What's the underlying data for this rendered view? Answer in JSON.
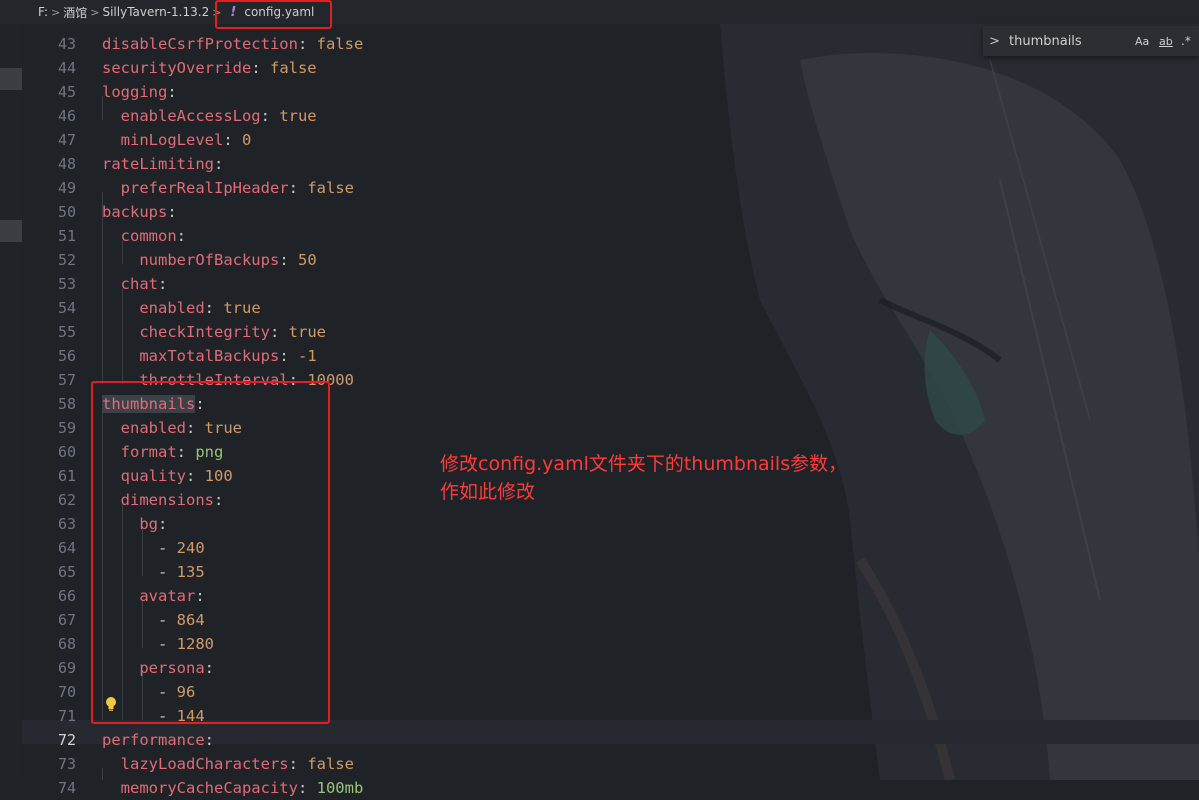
{
  "breadcrumb": {
    "segments": [
      "F:",
      "酒馆",
      "SillyTavern-1.13.2"
    ],
    "file_icon": "!",
    "file_name": "config.yaml"
  },
  "find_widget": {
    "query": "thumbnails",
    "case_label": "Aa",
    "word_label": "ab",
    "regex_label": ".*"
  },
  "annotation": {
    "line1": "修改config.yaml文件夹下的thumbnails参数，",
    "line2": "作如此修改"
  },
  "lines": [
    {
      "n": "43",
      "parts": [
        {
          "t": "disableCsrfProtection",
          "c": "k"
        },
        {
          "t": ": ",
          "c": "p"
        },
        {
          "t": "false",
          "c": "v"
        }
      ]
    },
    {
      "n": "44",
      "parts": [
        {
          "t": "securityOverride",
          "c": "k"
        },
        {
          "t": ": ",
          "c": "p"
        },
        {
          "t": "false",
          "c": "v"
        }
      ]
    },
    {
      "n": "45",
      "parts": [
        {
          "t": "logging",
          "c": "k"
        },
        {
          "t": ":",
          "c": "p"
        }
      ]
    },
    {
      "n": "46",
      "parts": [
        {
          "t": "  enableAccessLog",
          "c": "k"
        },
        {
          "t": ": ",
          "c": "p"
        },
        {
          "t": "true",
          "c": "v"
        }
      ]
    },
    {
      "n": "47",
      "parts": [
        {
          "t": "  minLogLevel",
          "c": "k"
        },
        {
          "t": ": ",
          "c": "p"
        },
        {
          "t": "0",
          "c": "v"
        }
      ]
    },
    {
      "n": "48",
      "parts": [
        {
          "t": "rateLimiting",
          "c": "k"
        },
        {
          "t": ":",
          "c": "p"
        }
      ]
    },
    {
      "n": "49",
      "parts": [
        {
          "t": "  preferRealIpHeader",
          "c": "k"
        },
        {
          "t": ": ",
          "c": "p"
        },
        {
          "t": "false",
          "c": "v"
        }
      ]
    },
    {
      "n": "50",
      "parts": [
        {
          "t": "backups",
          "c": "k"
        },
        {
          "t": ":",
          "c": "p"
        }
      ]
    },
    {
      "n": "51",
      "parts": [
        {
          "t": "  common",
          "c": "k"
        },
        {
          "t": ":",
          "c": "p"
        }
      ]
    },
    {
      "n": "52",
      "parts": [
        {
          "t": "    numberOfBackups",
          "c": "k"
        },
        {
          "t": ": ",
          "c": "p"
        },
        {
          "t": "50",
          "c": "v"
        }
      ]
    },
    {
      "n": "53",
      "parts": [
        {
          "t": "  chat",
          "c": "k"
        },
        {
          "t": ":",
          "c": "p"
        }
      ]
    },
    {
      "n": "54",
      "parts": [
        {
          "t": "    enabled",
          "c": "k"
        },
        {
          "t": ": ",
          "c": "p"
        },
        {
          "t": "true",
          "c": "v"
        }
      ]
    },
    {
      "n": "55",
      "parts": [
        {
          "t": "    checkIntegrity",
          "c": "k"
        },
        {
          "t": ": ",
          "c": "p"
        },
        {
          "t": "true",
          "c": "v"
        }
      ]
    },
    {
      "n": "56",
      "parts": [
        {
          "t": "    maxTotalBackups",
          "c": "k"
        },
        {
          "t": ": ",
          "c": "p"
        },
        {
          "t": "-1",
          "c": "v"
        }
      ]
    },
    {
      "n": "57",
      "parts": [
        {
          "t": "    throttleInterval",
          "c": "k"
        },
        {
          "t": ": ",
          "c": "p"
        },
        {
          "t": "10000",
          "c": "v"
        }
      ]
    },
    {
      "n": "58",
      "parts": [
        {
          "t": "thumbnails",
          "c": "k hl"
        },
        {
          "t": ":",
          "c": "p"
        }
      ]
    },
    {
      "n": "59",
      "parts": [
        {
          "t": "  enabled",
          "c": "k"
        },
        {
          "t": ": ",
          "c": "p"
        },
        {
          "t": "true",
          "c": "v"
        }
      ]
    },
    {
      "n": "60",
      "parts": [
        {
          "t": "  format",
          "c": "k"
        },
        {
          "t": ": ",
          "c": "p"
        },
        {
          "t": "png",
          "c": "s"
        }
      ]
    },
    {
      "n": "61",
      "parts": [
        {
          "t": "  quality",
          "c": "k"
        },
        {
          "t": ": ",
          "c": "p"
        },
        {
          "t": "100",
          "c": "v"
        }
      ]
    },
    {
      "n": "62",
      "parts": [
        {
          "t": "  dimensions",
          "c": "k"
        },
        {
          "t": ":",
          "c": "p"
        }
      ]
    },
    {
      "n": "63",
      "parts": [
        {
          "t": "    bg",
          "c": "k"
        },
        {
          "t": ":",
          "c": "p"
        }
      ]
    },
    {
      "n": "64",
      "parts": [
        {
          "t": "      - ",
          "c": "p"
        },
        {
          "t": "240",
          "c": "v"
        }
      ]
    },
    {
      "n": "65",
      "parts": [
        {
          "t": "      - ",
          "c": "p"
        },
        {
          "t": "135",
          "c": "v"
        }
      ]
    },
    {
      "n": "66",
      "parts": [
        {
          "t": "    avatar",
          "c": "k"
        },
        {
          "t": ":",
          "c": "p"
        }
      ]
    },
    {
      "n": "67",
      "parts": [
        {
          "t": "      - ",
          "c": "p"
        },
        {
          "t": "864",
          "c": "v"
        }
      ]
    },
    {
      "n": "68",
      "parts": [
        {
          "t": "      - ",
          "c": "p"
        },
        {
          "t": "1280",
          "c": "v"
        }
      ]
    },
    {
      "n": "69",
      "parts": [
        {
          "t": "    persona",
          "c": "k"
        },
        {
          "t": ":",
          "c": "p"
        }
      ]
    },
    {
      "n": "70",
      "parts": [
        {
          "t": "      - ",
          "c": "p"
        },
        {
          "t": "96",
          "c": "v"
        }
      ]
    },
    {
      "n": "71",
      "parts": [
        {
          "t": "      - ",
          "c": "p"
        },
        {
          "t": "144",
          "c": "v"
        }
      ]
    },
    {
      "n": "72",
      "parts": [
        {
          "t": "performance",
          "c": "k"
        },
        {
          "t": ":",
          "c": "p"
        }
      ]
    },
    {
      "n": "73",
      "parts": [
        {
          "t": "  lazyLoadCharacters",
          "c": "k"
        },
        {
          "t": ": ",
          "c": "p"
        },
        {
          "t": "false",
          "c": "v"
        }
      ]
    },
    {
      "n": "74",
      "parts": [
        {
          "t": "  memoryCacheCapacity",
          "c": "k"
        },
        {
          "t": ": ",
          "c": "p"
        },
        {
          "t": "100mb",
          "c": "s"
        }
      ]
    }
  ],
  "active_line": "72",
  "colors": {
    "key": "#e06c75",
    "value": "#d19a66",
    "string": "#98c379",
    "annotation": "#e02020"
  }
}
